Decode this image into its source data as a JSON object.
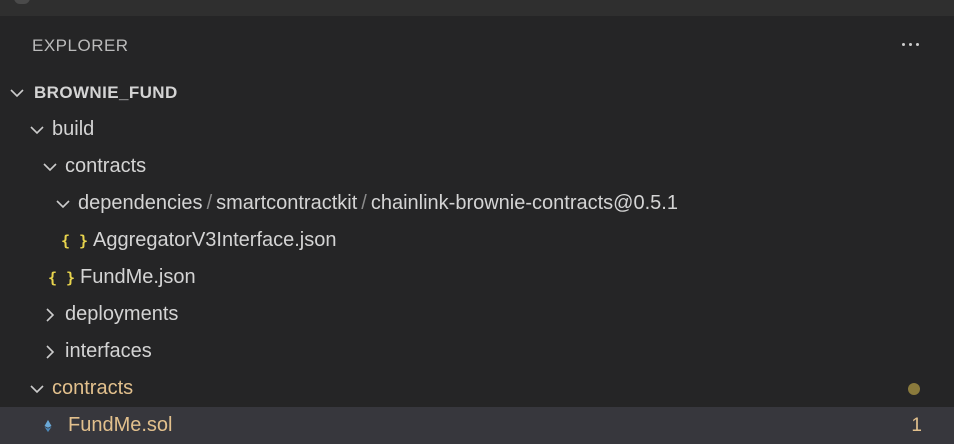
{
  "explorer": {
    "title": "EXPLORER",
    "more_icon": "ellipsis-icon"
  },
  "tree": {
    "root": {
      "label": "BROWNIE_FUND",
      "expanded": true
    },
    "build": {
      "label": "build",
      "expanded": true
    },
    "build_contracts": {
      "label": "contracts",
      "expanded": true
    },
    "dependencies": {
      "segments": [
        "dependencies",
        "smartcontractkit",
        "chainlink-brownie-contracts@0.5.1"
      ],
      "separator": "/",
      "expanded": true
    },
    "aggregator_file": {
      "label": "AggregatorV3Interface.json",
      "icon": "json-file-icon",
      "icon_text": "{ }"
    },
    "fundme_json": {
      "label": "FundMe.json",
      "icon": "json-file-icon",
      "icon_text": "{ }"
    },
    "deployments": {
      "label": "deployments",
      "expanded": false
    },
    "interfaces": {
      "label": "interfaces",
      "expanded": false
    },
    "contracts": {
      "label": "contracts",
      "expanded": true,
      "status": "modified-dot"
    },
    "fundme_sol": {
      "label": "FundMe.sol",
      "icon": "solidity-file-icon",
      "problem_count": "1",
      "selected": true
    }
  },
  "colors": {
    "background": "#252526",
    "selected_row": "#37373d",
    "json_icon": "#e8d44d",
    "warning_text": "#e2c08d",
    "solidity_icon": "#6aa9d8"
  }
}
